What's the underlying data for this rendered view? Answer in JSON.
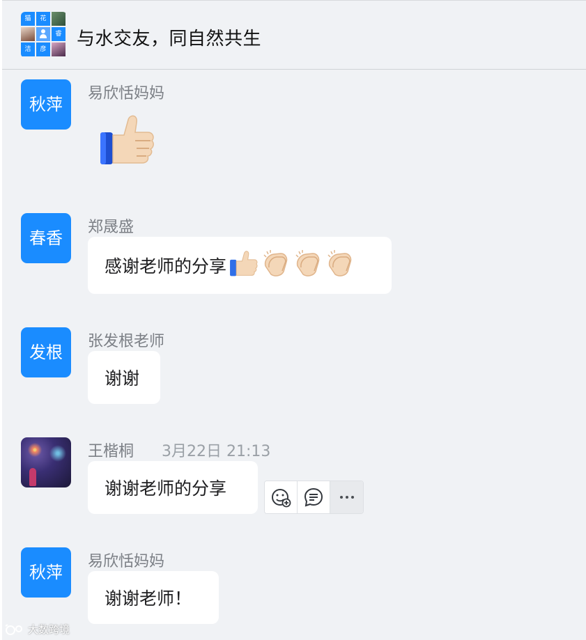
{
  "header": {
    "title": "与水交友，同自然共生",
    "group_avatar_cells": [
      "猫",
      "花",
      "",
      "",
      "",
      "睿",
      "洁",
      "彦",
      ""
    ]
  },
  "messages": [
    {
      "sender": "易欣恬妈妈",
      "avatar_text": "秋萍",
      "content_type": "emoji",
      "emoji": "thumbs-up"
    },
    {
      "sender": "郑晟盛",
      "avatar_text": "春香",
      "text": "感谢老师的分享",
      "emojis": [
        "thumbs-up",
        "clapping-hands",
        "clapping-hands",
        "clapping-hands"
      ]
    },
    {
      "sender": "张发根老师",
      "avatar_text": "发根",
      "text": "谢谢"
    },
    {
      "sender": "王楷桐",
      "avatar": "photo",
      "timestamp": "3月22日 21:13",
      "text": "谢谢老师的分享",
      "hover_actions": [
        "add-reaction-icon",
        "reply-icon",
        "more-icon"
      ]
    },
    {
      "sender": "易欣恬妈妈",
      "avatar_text": "秋萍",
      "text": "谢谢老师！"
    }
  ],
  "watermark": "大数跨境",
  "colors": {
    "accent": "#1a8cff",
    "background": "#f0f2f5",
    "bubble": "#ffffff",
    "sender": "#7b7f85"
  }
}
